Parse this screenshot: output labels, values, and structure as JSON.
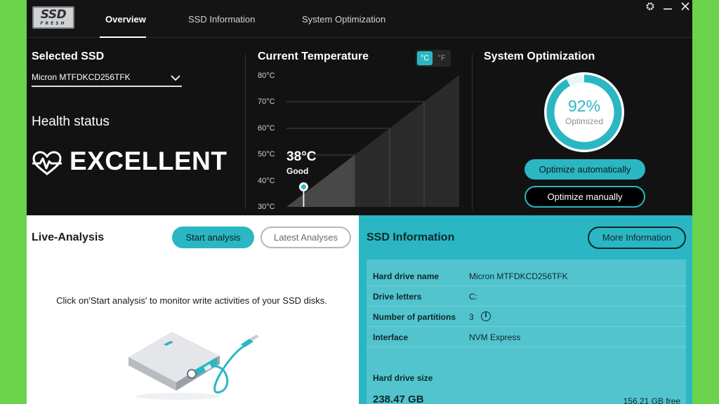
{
  "app": {
    "logo_text_top": "SSD",
    "logo_text_bottom": "FRESH",
    "tabs": [
      {
        "label": "Overview",
        "active": true
      },
      {
        "label": "SSD Information",
        "active": false
      },
      {
        "label": "System Optimization",
        "active": false
      }
    ],
    "window_controls": [
      "gear-icon",
      "minimize-icon",
      "close-icon"
    ]
  },
  "selected_ssd": {
    "title": "Selected SSD",
    "value": "Micron MTFDKCD256TFK",
    "health_label": "Health status",
    "health_value": "EXCELLENT"
  },
  "temperature": {
    "title": "Current Temperature",
    "unit_c": "°C",
    "unit_f": "°F",
    "active_unit": "C",
    "ticks": [
      "80°C",
      "70°C",
      "60°C",
      "50°C",
      "40°C",
      "30°C"
    ],
    "value": "38°C",
    "current_celsius": 38,
    "status": "Good"
  },
  "optimization": {
    "title": "System Optimization",
    "percent_text": "92%",
    "percent": 92,
    "label": "Optimized",
    "auto_button": "Optimize automatically",
    "manual_button": "Optimize manually"
  },
  "live_analysis": {
    "title": "Live-Analysis",
    "start_button": "Start analysis",
    "latest_button": "Latest Analyses",
    "message": "Click on'Start analysis' to monitor write activities of your SSD disks."
  },
  "ssd_info": {
    "title": "SSD Information",
    "more_button": "More Information",
    "rows": [
      {
        "key": "Hard drive name",
        "value": "Micron MTFDKCD256TFK"
      },
      {
        "key": "Drive letters",
        "value": "C:"
      },
      {
        "key": "Number of partitions",
        "value": "3"
      },
      {
        "key": "Interface",
        "value": "NVM Express"
      }
    ],
    "size_label": "Hard drive size",
    "size_value": "238.47 GB",
    "free_value": "156.21 GB free"
  },
  "colors": {
    "accent": "#2ab7c3",
    "background": "#121212",
    "outer": "#6ad34b"
  }
}
